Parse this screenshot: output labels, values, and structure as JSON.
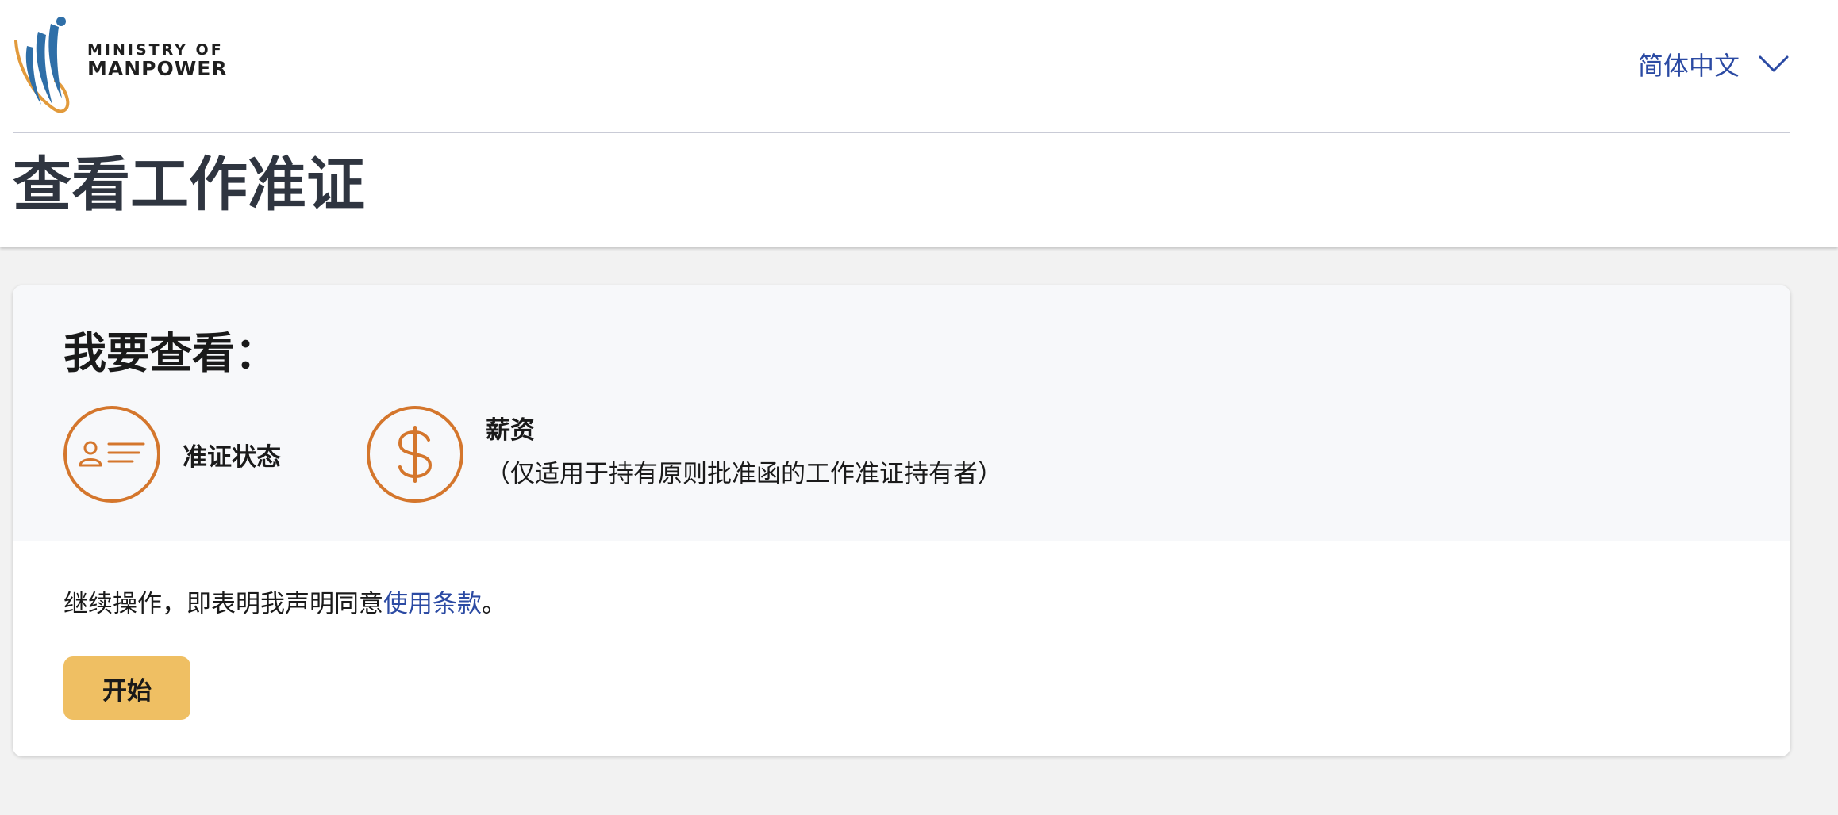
{
  "header": {
    "logo": {
      "line1": "MINISTRY OF",
      "line2": "MANPOWER"
    },
    "language": {
      "selected": "简体中文",
      "icon": "chevron-down-icon"
    },
    "title": "查看工作准证"
  },
  "card": {
    "heading": "我要查看：",
    "options": [
      {
        "label": "准证状态",
        "icon": "id-card-icon"
      },
      {
        "label": "薪资",
        "sublabel": "（仅适用于持有原则批准函的工作准证持有者）",
        "icon": "dollar-icon"
      }
    ],
    "terms": {
      "prefix": "继续操作，即表明我声明同意",
      "link": "使用条款",
      "suffix": "。"
    },
    "start_label": "开始"
  },
  "colors": {
    "accent_orange": "#d4762c",
    "link_blue": "#2b4aa3",
    "button_yellow": "#efbf63",
    "title_gray": "#2f3540",
    "page_background": "#f2f2f2"
  }
}
